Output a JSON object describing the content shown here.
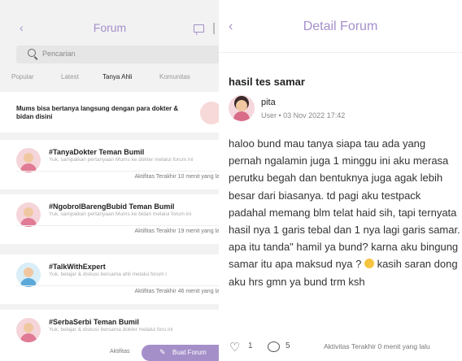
{
  "forum_list": {
    "back_icon": "‹",
    "title": "Forum",
    "search_placeholder": "Pencarian",
    "tabs": [
      "Popular",
      "Latest",
      "Tanya Ahli",
      "Komunitas"
    ],
    "active_tab": "Tanya Ahli",
    "banner_text": "Mums bisa bertanya langsung dengan para dokter & bidan disini",
    "cards": [
      {
        "name": "#TanyaDokter Teman Bumil",
        "desc": "Yuk, sampaikan pertanyaan Mums ke dokter melalui forum ini",
        "activity": "Aktifitas Terakhir 10 menit yang la"
      },
      {
        "name": "#NgobrolBarengBubid Teman Bumil",
        "desc": "Yuk, sampaikan pertanyaan Mums ke bidan melalui forum ini",
        "activity": "Aktifitas Terakhir 19 menit yang la"
      },
      {
        "name": "#TalkWithExpert",
        "desc": "Yuk, belajar & diskusi bersama ahli melalui forum i",
        "activity": "Aktifitas Terakhir 46 menit yang la"
      },
      {
        "name": "#SerbaSerbi Teman Bumil",
        "desc": "Yuk, belajar & diskusi bersama dokter melalui foru ini",
        "activity": "Aktifitas"
      }
    ],
    "fab_label": "Buat Forum",
    "fab_icon": "✎"
  },
  "detail": {
    "back_icon": "‹",
    "title": "Detail Forum",
    "post_title": "hasil tes samar",
    "user_name": "pita",
    "user_meta": "User • 03 Nov 2022 17:42",
    "body_part1": "haloo bund mau tanya siapa tau ada yang pernah ngalamin juga 1 minggu ini aku merasa perutku begah dan bentuknya juga agak lebih besar dari biasanya. td pagi aku testpack padahal memang blm telat haid sih, tapi ternyata hasil nya 1 garis tebal dan 1 nya lagi garis samar. apa itu tanda\" hamil ya bund? karna aku bingung samar itu apa maksud nya ?",
    "body_part2": "kasih saran dong aku hrs gmn ya bund trm ksh",
    "like_count": "1",
    "comment_count": "5",
    "last_activity": "Aktivitas Terakhir 0 menit yang lalu"
  },
  "colors": {
    "accent": "#a58fc9",
    "background_left": "#f2f2f2"
  }
}
